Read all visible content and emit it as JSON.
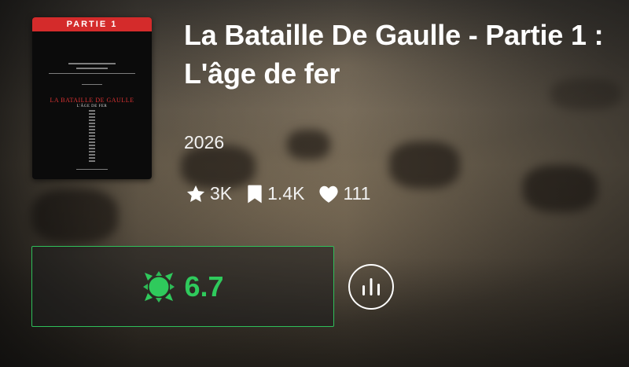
{
  "backdrop": {
    "kind": "movie-still-blurred"
  },
  "poster": {
    "banner_text": "PARTIE 1",
    "title_text": "LA BATAILLE DE GAULLE",
    "subtitle_text": "L'ÂGE DE FER",
    "banner_color": "#d42b2b"
  },
  "movie": {
    "title": "La Bataille De Gaulle - Partie 1 : L'âge de fer",
    "year": "2026"
  },
  "stats": {
    "favorites": {
      "icon": "star-icon",
      "value": "3K"
    },
    "bookmarks": {
      "icon": "bookmark-icon",
      "value": "1.4K"
    },
    "likes": {
      "icon": "heart-icon",
      "value": "111"
    }
  },
  "rating": {
    "icon": "score-badge-icon",
    "value": "6.7",
    "color": "#2fca5c"
  },
  "actions": {
    "stats_button_icon": "bar-chart-icon"
  }
}
